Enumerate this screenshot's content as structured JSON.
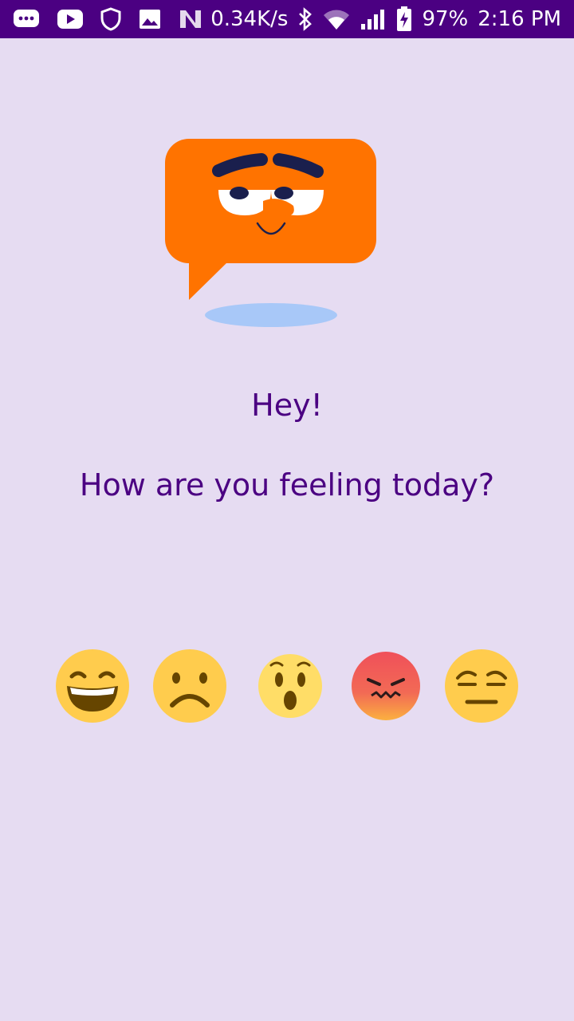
{
  "status_bar": {
    "network_speed": "0.34K/s",
    "battery_percent": "97%",
    "time": "2:16 PM",
    "icons": [
      "messages-icon",
      "youtube-icon",
      "shield-icon",
      "gallery-icon",
      "n-icon",
      "bluetooth-icon",
      "wifi-icon",
      "signal-icon",
      "battery-icon"
    ]
  },
  "main": {
    "greeting": "Hey!",
    "question": "How are you feeling today?"
  },
  "moods": [
    {
      "name": "happy"
    },
    {
      "name": "sad"
    },
    {
      "name": "surprised"
    },
    {
      "name": "angry"
    },
    {
      "name": "unamused"
    }
  ],
  "colors": {
    "status_bar": "#4b0082",
    "background": "#e6dcf2",
    "text": "#4b0082",
    "mascot_orange": "#ff7300",
    "mascot_shadow": "#a8c8f8",
    "emoji_yellow": "#ffcc4d",
    "angry_red": "#f05555"
  }
}
